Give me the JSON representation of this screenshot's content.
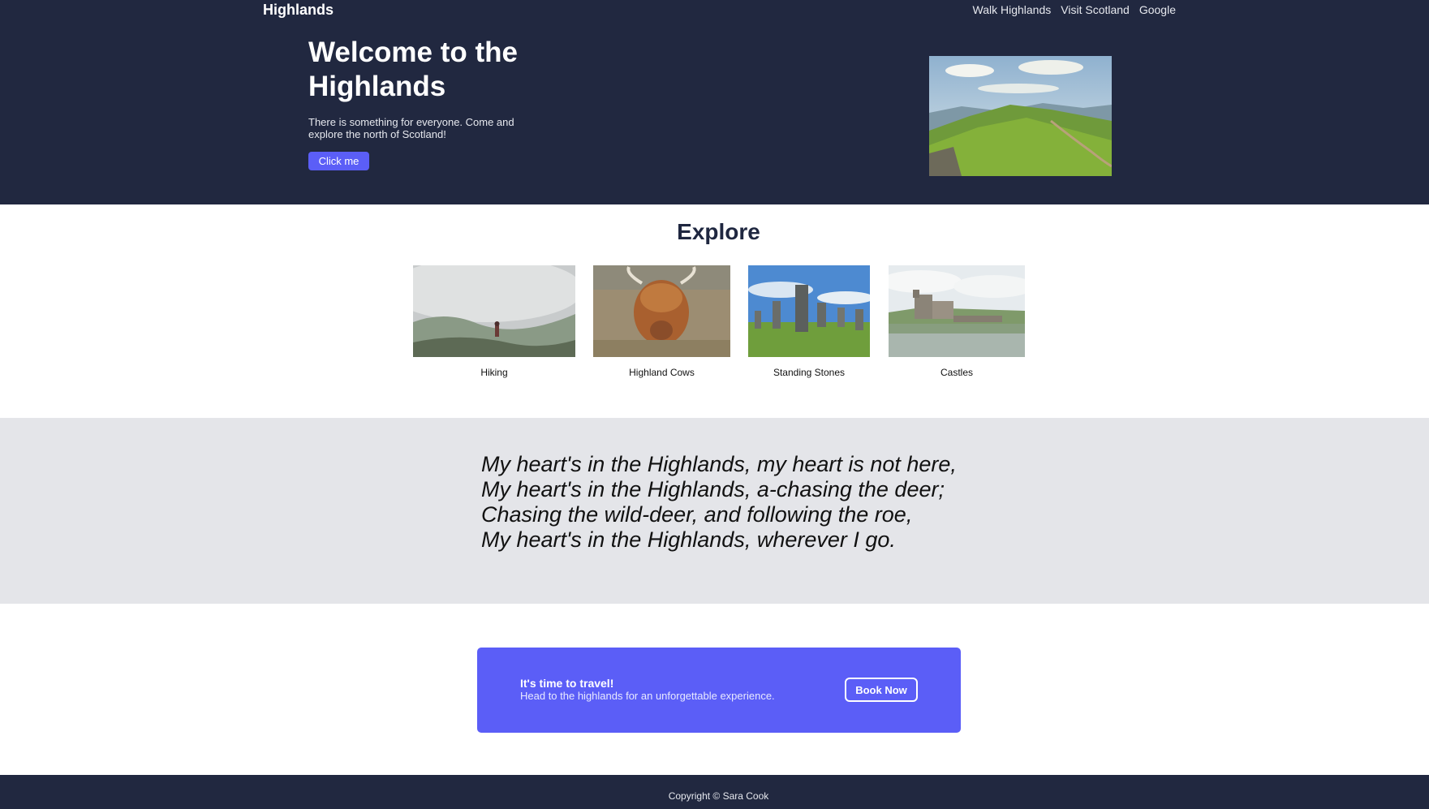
{
  "header": {
    "brand": "Highlands",
    "nav": [
      "Walk Highlands",
      "Visit Scotland",
      "Google"
    ]
  },
  "hero": {
    "title": "Welcome to the Highlands",
    "subtitle": "There is something for everyone. Come and explore the north of Scotland!",
    "button_label": "Click me",
    "image": "green-hills-landscape"
  },
  "explore": {
    "title": "Explore",
    "cards": [
      {
        "label": "Hiking",
        "image": "foggy-mountain-hiker"
      },
      {
        "label": "Highland Cows",
        "image": "highland-cow"
      },
      {
        "label": "Standing Stones",
        "image": "standing-stones"
      },
      {
        "label": "Castles",
        "image": "castle-on-loch"
      }
    ]
  },
  "quote": {
    "lines": [
      "My heart's in the Highlands, my heart is not here,",
      "My heart's in the Highlands, a-chasing the deer;",
      "Chasing the wild-deer, and following the roe,",
      "My heart's in the Highlands, wherever I go."
    ]
  },
  "cta": {
    "title": "It's time to travel!",
    "subtitle": "Head to the highlands for an unforgettable experience.",
    "button_label": "Book Now"
  },
  "footer": {
    "text": "Copyright © Sara Cook"
  },
  "colors": {
    "dark_navy": "#212840",
    "accent": "#5b5ef7",
    "quote_bg": "#e4e5e9"
  }
}
